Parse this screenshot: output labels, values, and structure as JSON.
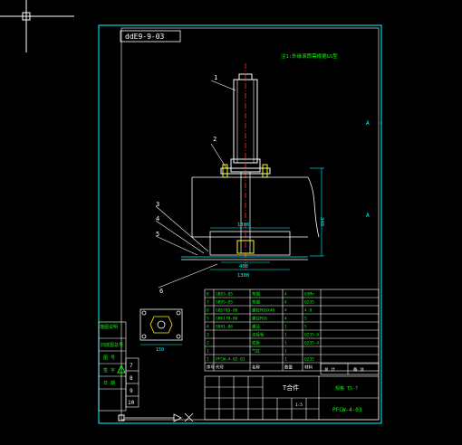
{
  "app": {
    "view": "model-space",
    "background": "#000000"
  },
  "colors": {
    "frame": "#00FFFF",
    "green": "#00FF00",
    "white": "#FFFFFF",
    "red": "#FF3030",
    "yellow": "#FFFF00"
  },
  "drawing": {
    "mirrored_number": "ddE9-9-03",
    "top_note": "注1:外缘滚筒需根据GS型",
    "frame_letter": "A"
  },
  "part_markers": [
    "1",
    "2",
    "3",
    "4",
    "5",
    "6"
  ],
  "dimensions": {
    "height": "340",
    "width": "1300",
    "span": "400",
    "base": "1300",
    "inset": "150"
  },
  "side_block": {
    "labels": [
      "描图说明",
      "旧底图总号",
      "图 号",
      "签 字",
      "日 期"
    ],
    "numbers": [
      "7",
      "8",
      "9",
      "10"
    ]
  },
  "bom": {
    "rows": [
      {
        "no": "8",
        "code": "GB93-85",
        "name": "垫圈",
        "qty": "4",
        "mat": "65Mn"
      },
      {
        "no": "7",
        "code": "GB95-85",
        "name": "垫圈",
        "qty": "4",
        "mat": "Q235"
      },
      {
        "no": "6",
        "code": "GB5783-86",
        "name": "螺栓M16X40",
        "qty": "4",
        "mat": "4.8"
      },
      {
        "no": "5",
        "code": "GB6170-86",
        "name": "螺母M16",
        "qty": "4",
        "mat": "5"
      },
      {
        "no": "4",
        "code": "GB41-86",
        "name": "螺母",
        "qty": "1",
        "mat": "5"
      },
      {
        "no": "3",
        "code": "",
        "name": "连接板",
        "qty": "1",
        "mat": "Q235-A"
      },
      {
        "no": "2",
        "code": "",
        "name": "底板",
        "qty": "1",
        "mat": "Q235-A"
      },
      {
        "no": "1",
        "code": "",
        "name": "气缸",
        "qty": "1",
        "mat": ""
      },
      {
        "no": "1",
        "code": "PFCW-4-02-01",
        "name": "",
        "qty": "1",
        "mat": "Q235"
      }
    ],
    "header": {
      "no": "序号",
      "code": "代号",
      "name": "名称",
      "qty": "数量",
      "mat": "材料"
    },
    "right_cells": [
      "总 计",
      "备 注"
    ]
  },
  "title_block": {
    "title": "T合件",
    "subtitle": "规格 TS-7",
    "drawing_no": "PFCW-4-03",
    "scale": "1:5"
  }
}
